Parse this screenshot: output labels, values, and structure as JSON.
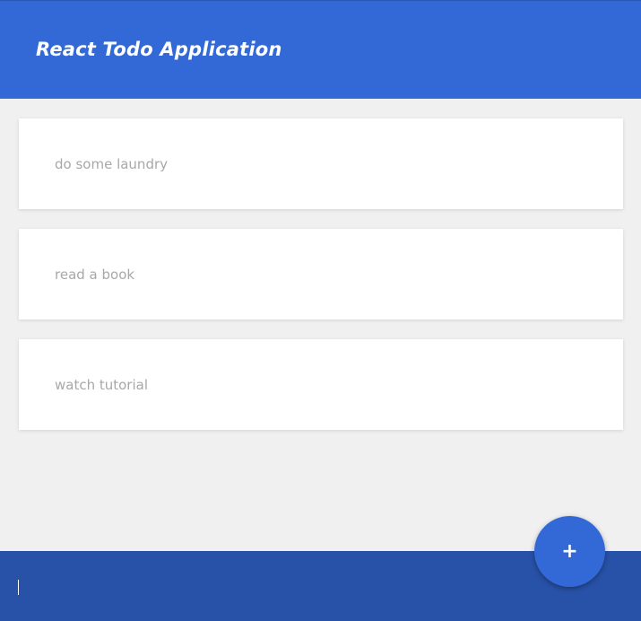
{
  "header": {
    "title": "React Todo Application"
  },
  "todos": [
    {
      "text": "do some laundry"
    },
    {
      "text": "read a book"
    },
    {
      "text": "watch tutorial"
    }
  ],
  "footer": {
    "input_value": "",
    "add_button_label": "+"
  },
  "colors": {
    "header_bg": "#3369d6",
    "footer_bg": "#2852a8",
    "fab_bg": "#3369d6",
    "page_bg": "#f0f0f0",
    "todo_text": "#a8a8a8"
  }
}
